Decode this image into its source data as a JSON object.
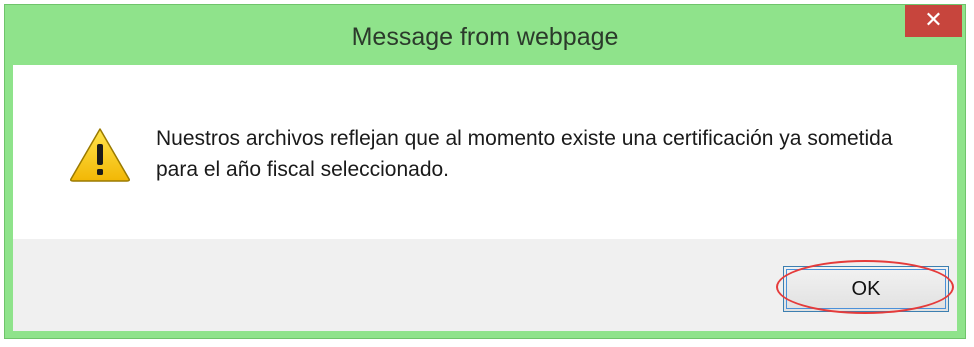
{
  "dialog": {
    "title": "Message from webpage",
    "close_label": "✕",
    "message": "Nuestros archivos reflejan que al momento existe una certificación ya sometida para el año fiscal seleccionado.",
    "icon": "warning-icon",
    "ok_label": "OK"
  },
  "colors": {
    "titlebar": "#8fe38b",
    "close_button": "#c7453d",
    "annotation": "#e53b3b",
    "button_area": "#f0f0f0"
  }
}
